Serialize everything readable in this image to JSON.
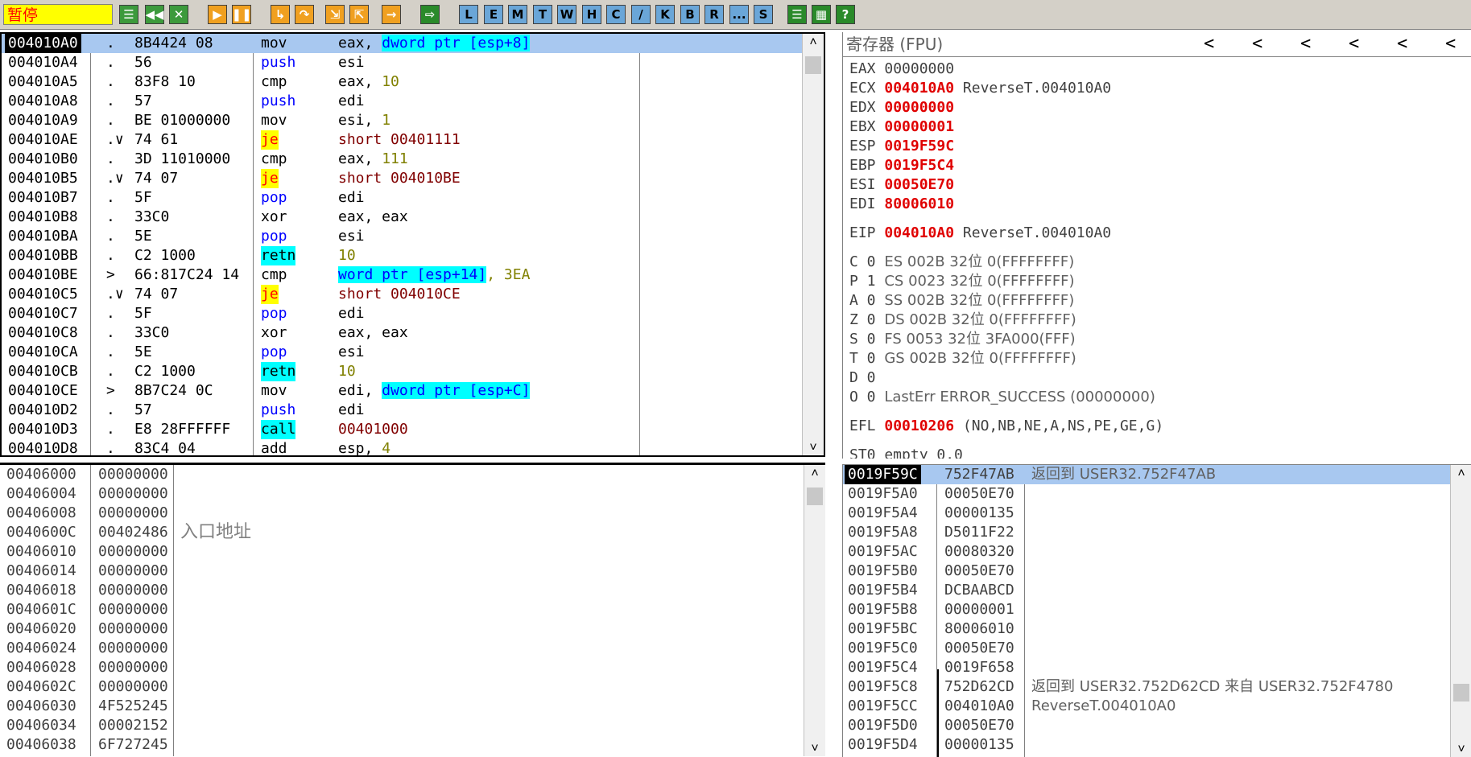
{
  "toolbar": {
    "status": "暂停",
    "letter_buttons": [
      "L",
      "E",
      "M",
      "T",
      "W",
      "H",
      "C",
      "/",
      "K",
      "B",
      "R",
      "...",
      "S"
    ],
    "help": "?"
  },
  "disasm": {
    "rows": [
      {
        "addr": "004010A0",
        "mark": ".",
        "hex": "8B4424 08",
        "mn": "mov",
        "op": "eax, ",
        "memop": "dword ptr [esp+8]",
        "tail": ""
      },
      {
        "addr": "004010A4",
        "mark": ".",
        "hex": "56",
        "mn": "push",
        "op": "esi",
        "memop": "",
        "tail": ""
      },
      {
        "addr": "004010A5",
        "mark": ".",
        "hex": "83F8 10",
        "mn": "cmp",
        "op": "eax, ",
        "memop": "",
        "tail": "10"
      },
      {
        "addr": "004010A8",
        "mark": ".",
        "hex": "57",
        "mn": "push",
        "op": "edi",
        "memop": "",
        "tail": ""
      },
      {
        "addr": "004010A9",
        "mark": ".",
        "hex": "BE 01000000",
        "mn": "mov",
        "op": "esi, ",
        "memop": "",
        "tail": "1"
      },
      {
        "addr": "004010AE",
        "mark": ".∨",
        "hex": "74 61",
        "mn": "je",
        "op": "short 00401111",
        "memop": "",
        "tail": ""
      },
      {
        "addr": "004010B0",
        "mark": ".",
        "hex": "3D 11010000",
        "mn": "cmp",
        "op": "eax, ",
        "memop": "",
        "tail": "111"
      },
      {
        "addr": "004010B5",
        "mark": ".∨",
        "hex": "74 07",
        "mn": "je",
        "op": "short 004010BE",
        "memop": "",
        "tail": ""
      },
      {
        "addr": "004010B7",
        "mark": ".",
        "hex": "5F",
        "mn": "pop",
        "op": "edi",
        "memop": "",
        "tail": ""
      },
      {
        "addr": "004010B8",
        "mark": ".",
        "hex": "33C0",
        "mn": "xor",
        "op": "eax, eax",
        "memop": "",
        "tail": ""
      },
      {
        "addr": "004010BA",
        "mark": ".",
        "hex": "5E",
        "mn": "pop",
        "op": "esi",
        "memop": "",
        "tail": ""
      },
      {
        "addr": "004010BB",
        "mark": ".",
        "hex": "C2 1000",
        "mn": "retn",
        "op": "",
        "memop": "",
        "tail": "10"
      },
      {
        "addr": "004010BE",
        "mark": ">",
        "hex": "66:817C24 14",
        "mn": "cmp",
        "op": "",
        "memop": "word ptr [esp+14]",
        "tail": ", 3EA"
      },
      {
        "addr": "004010C5",
        "mark": ".∨",
        "hex": "74 07",
        "mn": "je",
        "op": "short 004010CE",
        "memop": "",
        "tail": ""
      },
      {
        "addr": "004010C7",
        "mark": ".",
        "hex": "5F",
        "mn": "pop",
        "op": "edi",
        "memop": "",
        "tail": ""
      },
      {
        "addr": "004010C8",
        "mark": ".",
        "hex": "33C0",
        "mn": "xor",
        "op": "eax, eax",
        "memop": "",
        "tail": ""
      },
      {
        "addr": "004010CA",
        "mark": ".",
        "hex": "5E",
        "mn": "pop",
        "op": "esi",
        "memop": "",
        "tail": ""
      },
      {
        "addr": "004010CB",
        "mark": ".",
        "hex": "C2 1000",
        "mn": "retn",
        "op": "",
        "memop": "",
        "tail": "10"
      },
      {
        "addr": "004010CE",
        "mark": ">",
        "hex": "8B7C24 0C",
        "mn": "mov",
        "op": "edi, ",
        "memop": "dword ptr [esp+C]",
        "tail": ""
      },
      {
        "addr": "004010D2",
        "mark": ".",
        "hex": "57",
        "mn": "push",
        "op": "edi",
        "memop": "",
        "tail": ""
      },
      {
        "addr": "004010D3",
        "mark": ".",
        "hex": "E8 28FFFFFF",
        "mn": "call",
        "op": "00401000",
        "memop": "",
        "tail": ""
      },
      {
        "addr": "004010D8",
        "mark": ".",
        "hex": "83C4 04",
        "mn": "add",
        "op": "esp, ",
        "memop": "",
        "tail": "4"
      }
    ]
  },
  "registers": {
    "title": "寄存器 (FPU)",
    "gp": [
      {
        "name": "EAX",
        "value": "00000000",
        "highlight": false,
        "comment": ""
      },
      {
        "name": "ECX",
        "value": "004010A0",
        "highlight": true,
        "comment": "ReverseT.004010A0"
      },
      {
        "name": "EDX",
        "value": "00000000",
        "highlight": true,
        "comment": ""
      },
      {
        "name": "EBX",
        "value": "00000001",
        "highlight": true,
        "comment": ""
      },
      {
        "name": "ESP",
        "value": "0019F59C",
        "highlight": true,
        "comment": ""
      },
      {
        "name": "EBP",
        "value": "0019F5C4",
        "highlight": true,
        "comment": ""
      },
      {
        "name": "ESI",
        "value": "00050E70",
        "highlight": true,
        "comment": ""
      },
      {
        "name": "EDI",
        "value": "80006010",
        "highlight": true,
        "comment": ""
      }
    ],
    "eip": {
      "name": "EIP",
      "value": "004010A0",
      "comment": "ReverseT.004010A0"
    },
    "seg": [
      {
        "flag": "C 0",
        "text": "ES 002B 32位 0(FFFFFFFF)"
      },
      {
        "flag": "P 1",
        "text": "CS 0023 32位 0(FFFFFFFF)"
      },
      {
        "flag": "A 0",
        "text": "SS 002B 32位 0(FFFFFFFF)"
      },
      {
        "flag": "Z 0",
        "text": "DS 002B 32位 0(FFFFFFFF)"
      },
      {
        "flag": "S 0",
        "text": "FS 0053 32位 3FA000(FFF)"
      },
      {
        "flag": "T 0",
        "text": "GS 002B 32位 0(FFFFFFFF)"
      },
      {
        "flag": "D 0",
        "text": ""
      },
      {
        "flag": "O 0",
        "text": "LastErr ERROR_SUCCESS (00000000)"
      }
    ],
    "efl": {
      "name": "EFL",
      "value": "00010206",
      "comment": "(NO,NB,NE,A,NS,PE,GE,G)"
    },
    "st0": "ST0 empty 0.0"
  },
  "dump": {
    "rows": [
      {
        "addr": "00406000",
        "value": "00000000",
        "comment": ""
      },
      {
        "addr": "00406004",
        "value": "00000000",
        "comment": ""
      },
      {
        "addr": "00406008",
        "value": "00000000",
        "comment": ""
      },
      {
        "addr": "0040600C",
        "value": "00402486",
        "comment": "入口地址"
      },
      {
        "addr": "00406010",
        "value": "00000000",
        "comment": ""
      },
      {
        "addr": "00406014",
        "value": "00000000",
        "comment": ""
      },
      {
        "addr": "00406018",
        "value": "00000000",
        "comment": ""
      },
      {
        "addr": "0040601C",
        "value": "00000000",
        "comment": ""
      },
      {
        "addr": "00406020",
        "value": "00000000",
        "comment": ""
      },
      {
        "addr": "00406024",
        "value": "00000000",
        "comment": ""
      },
      {
        "addr": "00406028",
        "value": "00000000",
        "comment": ""
      },
      {
        "addr": "0040602C",
        "value": "00000000",
        "comment": ""
      },
      {
        "addr": "00406030",
        "value": "4F525245",
        "comment": ""
      },
      {
        "addr": "00406034",
        "value": "00002152",
        "comment": ""
      },
      {
        "addr": "00406038",
        "value": "6F727245",
        "comment": ""
      }
    ]
  },
  "stack": {
    "rows": [
      {
        "addr": "0019F59C",
        "value": "752F47AB",
        "comment": "返回到 USER32.752F47AB"
      },
      {
        "addr": "0019F5A0",
        "value": "00050E70",
        "comment": ""
      },
      {
        "addr": "0019F5A4",
        "value": "00000135",
        "comment": ""
      },
      {
        "addr": "0019F5A8",
        "value": "D5011F22",
        "comment": ""
      },
      {
        "addr": "0019F5AC",
        "value": "00080320",
        "comment": ""
      },
      {
        "addr": "0019F5B0",
        "value": "00050E70",
        "comment": ""
      },
      {
        "addr": "0019F5B4",
        "value": "DCBAABCD",
        "comment": ""
      },
      {
        "addr": "0019F5B8",
        "value": "00000001",
        "comment": ""
      },
      {
        "addr": "0019F5BC",
        "value": "80006010",
        "comment": ""
      },
      {
        "addr": "0019F5C0",
        "value": "00050E70",
        "comment": ""
      },
      {
        "addr": "0019F5C4",
        "value": "0019F658",
        "comment": ""
      },
      {
        "addr": "0019F5C8",
        "value": "752D62CD",
        "comment": "返回到 USER32.752D62CD 来自 USER32.752F4780"
      },
      {
        "addr": "0019F5CC",
        "value": "004010A0",
        "comment": "ReverseT.004010A0"
      },
      {
        "addr": "0019F5D0",
        "value": "00050E70",
        "comment": ""
      },
      {
        "addr": "0019F5D4",
        "value": "00000135",
        "comment": ""
      }
    ]
  }
}
